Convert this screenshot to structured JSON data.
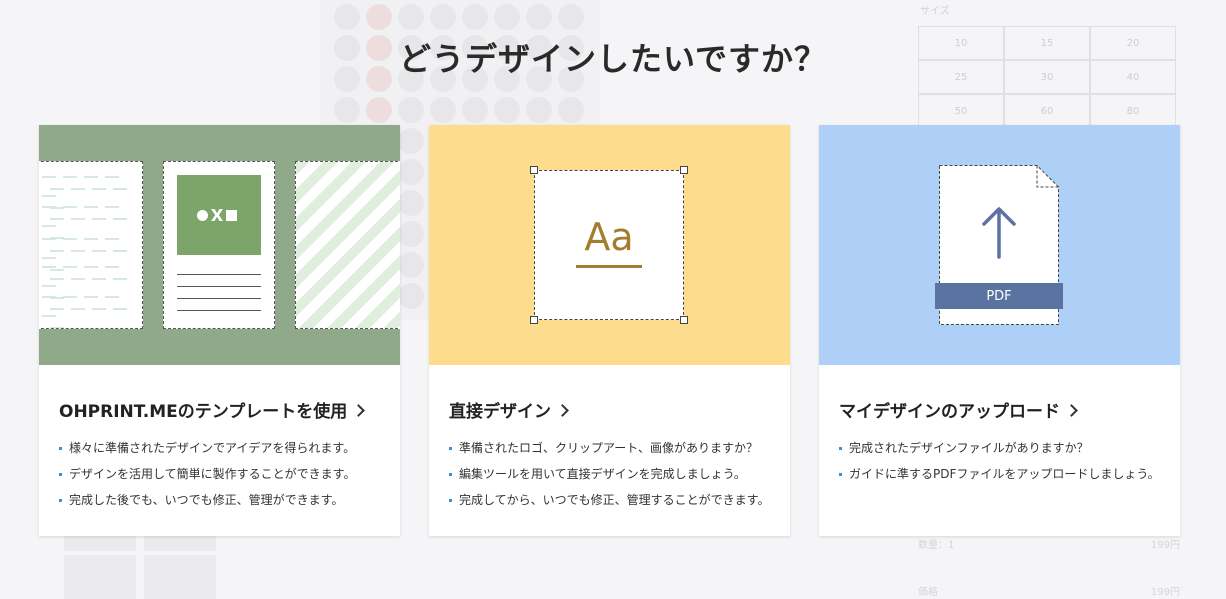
{
  "overlay": {
    "title": "どうデザインしたいですか？"
  },
  "cards": [
    {
      "heading": "OHPRINT.MEのテンプレートを使用",
      "items": [
        "様々に準備されたデザインでアイデアを得られます。",
        "デザインを活用して簡単に製作することができます。",
        "完成した後でも、いつでも修正、管理ができます。"
      ]
    },
    {
      "heading": "直接デザイン",
      "visual_text": "Aa",
      "items": [
        "準備されたロゴ、クリップアート、画像がありますか？",
        "編集ツールを用いて直接デザインを完成しましょう。",
        "完成してから、いつでも修正、管理することができます。"
      ]
    },
    {
      "heading": "マイデザインのアップロード",
      "visual_text": "PDF",
      "items": [
        "完成されたデザインファイルがありますか？",
        "ガイドに準するPDFファイルをアップロードしましょう。"
      ]
    }
  ],
  "background": {
    "size_label": "サイズ",
    "sizes": [
      "10",
      "15",
      "20",
      "25",
      "30",
      "40",
      "50",
      "60",
      "80"
    ],
    "quantity_label": "数量：1",
    "quantity_price": "199円",
    "price_label": "価格",
    "price_value": "199円"
  },
  "colors": {
    "template_bg": "#8fa98a",
    "direct_bg": "#fedc8e",
    "upload_bg": "#aed0f6",
    "accent_gold": "#a27d2c",
    "pdf_band": "#5a73a0",
    "bullet": "#3e8fd6"
  }
}
